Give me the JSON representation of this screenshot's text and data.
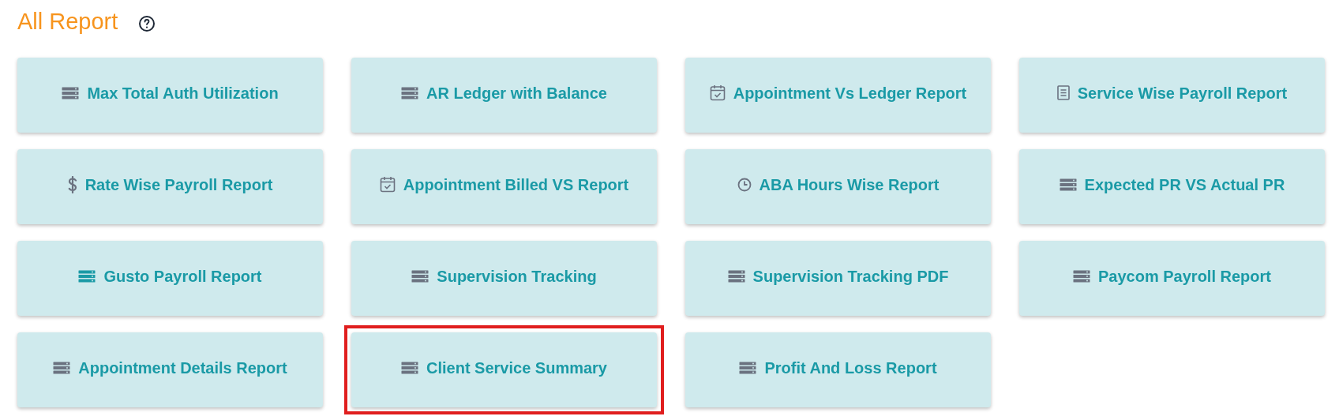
{
  "title": "All Report",
  "reports": [
    {
      "label": "Max Total Auth Utilization",
      "kind": "server",
      "selected": false
    },
    {
      "label": "AR Ledger with Balance",
      "kind": "server",
      "selected": false
    },
    {
      "label": "Appointment Vs Ledger Report",
      "kind": "calendar",
      "selected": false
    },
    {
      "label": "Service Wise Payroll Report",
      "kind": "document",
      "selected": false
    },
    {
      "label": "Rate Wise Payroll Report",
      "kind": "dollar",
      "selected": false
    },
    {
      "label": "Appointment Billed VS Report",
      "kind": "calendar",
      "selected": false
    },
    {
      "label": "ABA Hours Wise Report",
      "kind": "clock",
      "selected": false
    },
    {
      "label": "Expected PR VS Actual PR",
      "kind": "server",
      "selected": false
    },
    {
      "label": "Gusto Payroll Report",
      "kind": "accent",
      "selected": false
    },
    {
      "label": "Supervision Tracking",
      "kind": "server",
      "selected": false
    },
    {
      "label": "Supervision Tracking PDF",
      "kind": "server",
      "selected": false
    },
    {
      "label": "Paycom Payroll Report",
      "kind": "server",
      "selected": false
    },
    {
      "label": "Appointment Details Report",
      "kind": "server",
      "selected": false
    },
    {
      "label": "Client Service Summary",
      "kind": "server",
      "selected": true
    },
    {
      "label": "Profit And Loss Report",
      "kind": "server",
      "selected": false
    }
  ]
}
